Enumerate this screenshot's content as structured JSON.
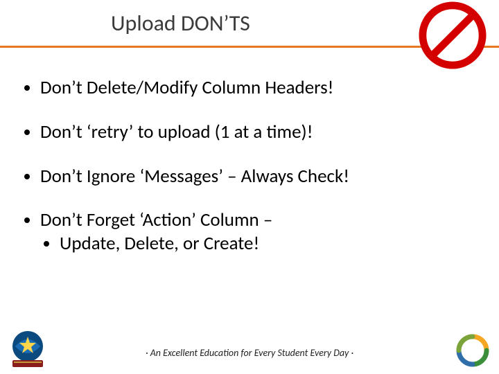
{
  "title": "Upload DON’TS",
  "bullets": {
    "b1": "Don’t Delete/Modify Column Headers!",
    "b2": "Don’t ‘retry’ to upload (1 at a time)!",
    "b3": "Don’t Ignore ‘Messages’ – Always Check!",
    "b4": "Don’t Forget ‘Action’ Column –",
    "b4sub": "Update, Delete, or Create!"
  },
  "footer": "· An Excellent Education for Every Student Every Day ·"
}
